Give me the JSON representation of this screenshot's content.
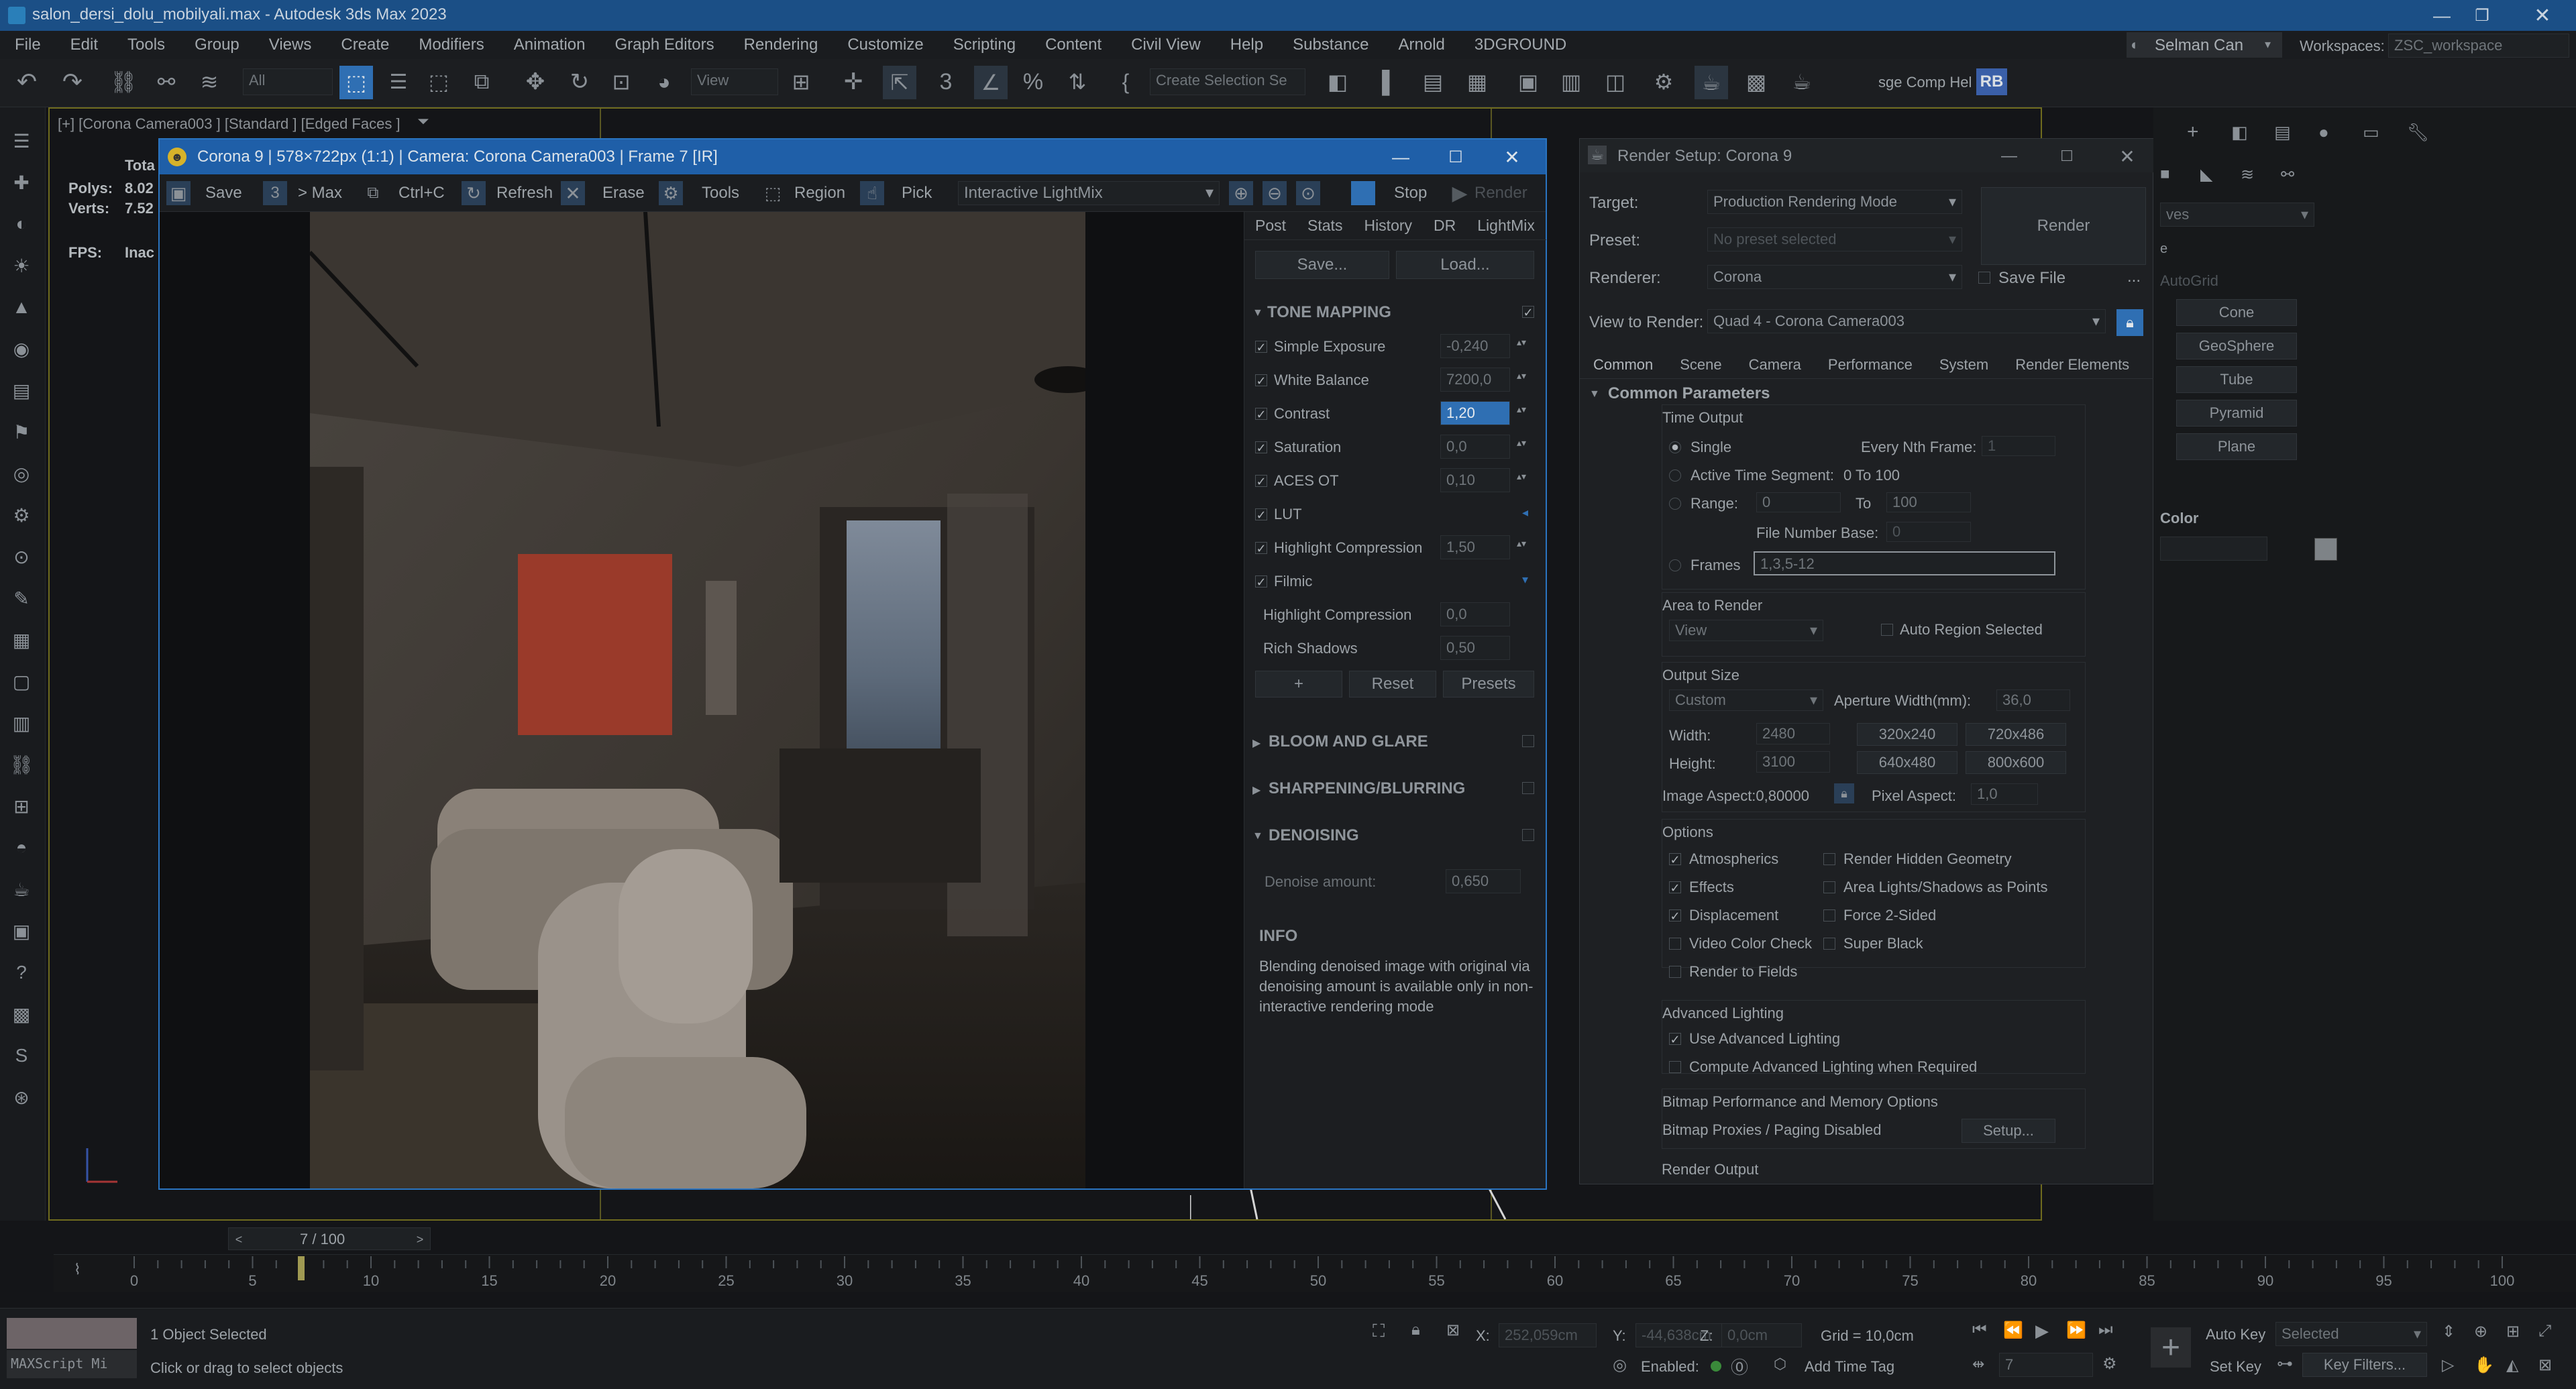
{
  "titlebar": {
    "title": "salon_dersi_dolu_mobilyali.max - Autodesk 3ds Max 2023"
  },
  "menu": [
    "File",
    "Edit",
    "Tools",
    "Group",
    "Views",
    "Create",
    "Modifiers",
    "Animation",
    "Graph Editors",
    "Rendering",
    "Customize",
    "Scripting",
    "Content",
    "Civil View",
    "Help",
    "Substance",
    "Arnold",
    "3DGROUND"
  ],
  "user": {
    "name": "Selman Can",
    "workspaces_label": "Workspaces:",
    "workspace": "ZSC_workspace"
  },
  "toolbar": {
    "filter": "All",
    "view": "View",
    "selection_set": "Create Selection Se",
    "comp": "sge Comp Hel",
    "rb": "RB"
  },
  "viewport": {
    "label": "[+] [Corona Camera003 ] [Standard ] [Edged Faces ]",
    "stats": {
      "total": "Tota",
      "polys_label": "Polys:",
      "polys": "8.02",
      "verts_label": "Verts:",
      "verts": "7.52",
      "fps_label": "FPS:",
      "fps": "Inac"
    }
  },
  "vfb": {
    "title": "Corona 9 | 578×722px (1:1) | Camera: Corona Camera003 | Frame 7 [IR]",
    "toolbar": {
      "save": "Save",
      "max": "> Max",
      "copy": "Ctrl+C",
      "refresh": "Refresh",
      "erase": "Erase",
      "tools": "Tools",
      "region": "Region",
      "pick": "Pick",
      "mode": "Interactive LightMix",
      "stop": "Stop",
      "render": "Render"
    },
    "tabs": [
      "Post",
      "Stats",
      "History",
      "DR",
      "LightMix"
    ],
    "save_btn": "Save...",
    "load_btn": "Load...",
    "tone_mapping": {
      "header": "TONE MAPPING",
      "items": [
        {
          "label": "Simple Exposure",
          "value": "-0,240"
        },
        {
          "label": "White Balance",
          "value": "7200,0"
        },
        {
          "label": "Contrast",
          "value": "1,20"
        },
        {
          "label": "Saturation",
          "value": "0,0"
        },
        {
          "label": "ACES OT",
          "value": "0,10"
        },
        {
          "label": "LUT",
          "value": ""
        },
        {
          "label": "Highlight Compression",
          "value": "1,50"
        },
        {
          "label": "Filmic",
          "value": ""
        }
      ],
      "filmic": [
        {
          "label": "Highlight Compression",
          "value": "0,0"
        },
        {
          "label": "Rich Shadows",
          "value": "0,50"
        }
      ],
      "plus": "+",
      "reset": "Reset",
      "presets": "Presets"
    },
    "bloom": "BLOOM AND GLARE",
    "sharpen": "SHARPENING/BLURRING",
    "denoise": "DENOISING",
    "denoise_amount_label": "Denoise amount:",
    "denoise_amount": "0,650",
    "info_header": "INFO",
    "info_text": "Blending denoised image with original via denoising amount is available only in non-interactive rendering mode"
  },
  "render_setup": {
    "title": "Render Setup: Corona 9",
    "target_label": "Target:",
    "target": "Production Rendering Mode",
    "preset_label": "Preset:",
    "preset": "No preset selected",
    "renderer_label": "Renderer:",
    "renderer": "Corona",
    "save_file": "Save File",
    "view_label": "View to Render:",
    "view": "Quad 4 - Corona Camera003",
    "render_btn": "Render",
    "tabs": [
      "Common",
      "Scene",
      "Camera",
      "Performance",
      "System",
      "Render Elements"
    ],
    "common_params": "Common Parameters",
    "time_output": "Time Output",
    "single": "Single",
    "every_nth": "Every Nth Frame:",
    "every_nth_val": "1",
    "active_seg": "Active Time Segment:",
    "active_seg_val": "0 To 100",
    "range": "Range:",
    "range_from": "0",
    "range_to_label": "To",
    "range_to": "100",
    "file_num_base": "File Number Base:",
    "file_num_val": "0",
    "frames": "Frames",
    "frames_val": "1,3,5-12",
    "area_to_render": "Area to Render",
    "area_val": "View",
    "auto_region": "Auto Region Selected",
    "output_size": "Output Size",
    "size_preset": "Custom",
    "aperture_label": "Aperture Width(mm):",
    "aperture": "36,0",
    "width_label": "Width:",
    "width": "2480",
    "height_label": "Height:",
    "height": "3100",
    "presets": [
      "320x240",
      "720x486",
      "640x480",
      "800x600"
    ],
    "image_aspect": "Image Aspect:0,80000",
    "pixel_aspect_label": "Pixel Aspect:",
    "pixel_aspect": "1,0",
    "options": "Options",
    "opts": [
      {
        "label": "Atmospherics",
        "on": true
      },
      {
        "label": "Render Hidden Geometry",
        "on": false
      },
      {
        "label": "Effects",
        "on": true
      },
      {
        "label": "Area Lights/Shadows as Points",
        "on": false
      },
      {
        "label": "Displacement",
        "on": true
      },
      {
        "label": "Force 2-Sided",
        "on": false
      },
      {
        "label": "Video Color Check",
        "on": false
      },
      {
        "label": "Super Black",
        "on": false
      },
      {
        "label": "Render to Fields",
        "on": false
      }
    ],
    "adv_lighting": "Advanced Lighting",
    "use_adv": "Use Advanced Lighting",
    "compute_adv": "Compute Advanced Lighting when Required",
    "bitmap_perf": "Bitmap Performance and Memory Options",
    "bitmap_proxies": "Bitmap Proxies / Paging Disabled",
    "setup_btn": "Setup...",
    "render_output": "Render Output"
  },
  "command_panel": {
    "dropdown": "ves",
    "autogrid": "AutoGrid",
    "buttons": [
      "Cone",
      "GeoSphere",
      "Tube",
      "Pyramid",
      "Plane"
    ],
    "color": "Color"
  },
  "timeline": {
    "frame": "7 / 100",
    "ticks": [
      "0",
      "5",
      "10",
      "15",
      "20",
      "25",
      "30",
      "35",
      "40",
      "45",
      "50",
      "55",
      "60",
      "65",
      "70",
      "75",
      "80",
      "85",
      "90",
      "95",
      "100"
    ]
  },
  "status": {
    "maxscript": "MAXScript Mi",
    "selected": "1 Object Selected",
    "hint": "Click or drag to select objects",
    "x_label": "X:",
    "x": "252,059cm",
    "y_label": "Y:",
    "y": "-44,638cm",
    "z_label": "Z:",
    "z": "0,0cm",
    "grid": "Grid = 10,0cm",
    "enabled": "Enabled:",
    "add_time_tag": "Add Time Tag",
    "auto_key": "Auto Key",
    "set_key": "Set Key",
    "selected_dd": "Selected",
    "key_filters": "Key Filters...",
    "frame": "7"
  },
  "colors": {
    "accent": "#2f6fb3",
    "title_blue": "#1f5fa8",
    "bg": "#141518"
  }
}
